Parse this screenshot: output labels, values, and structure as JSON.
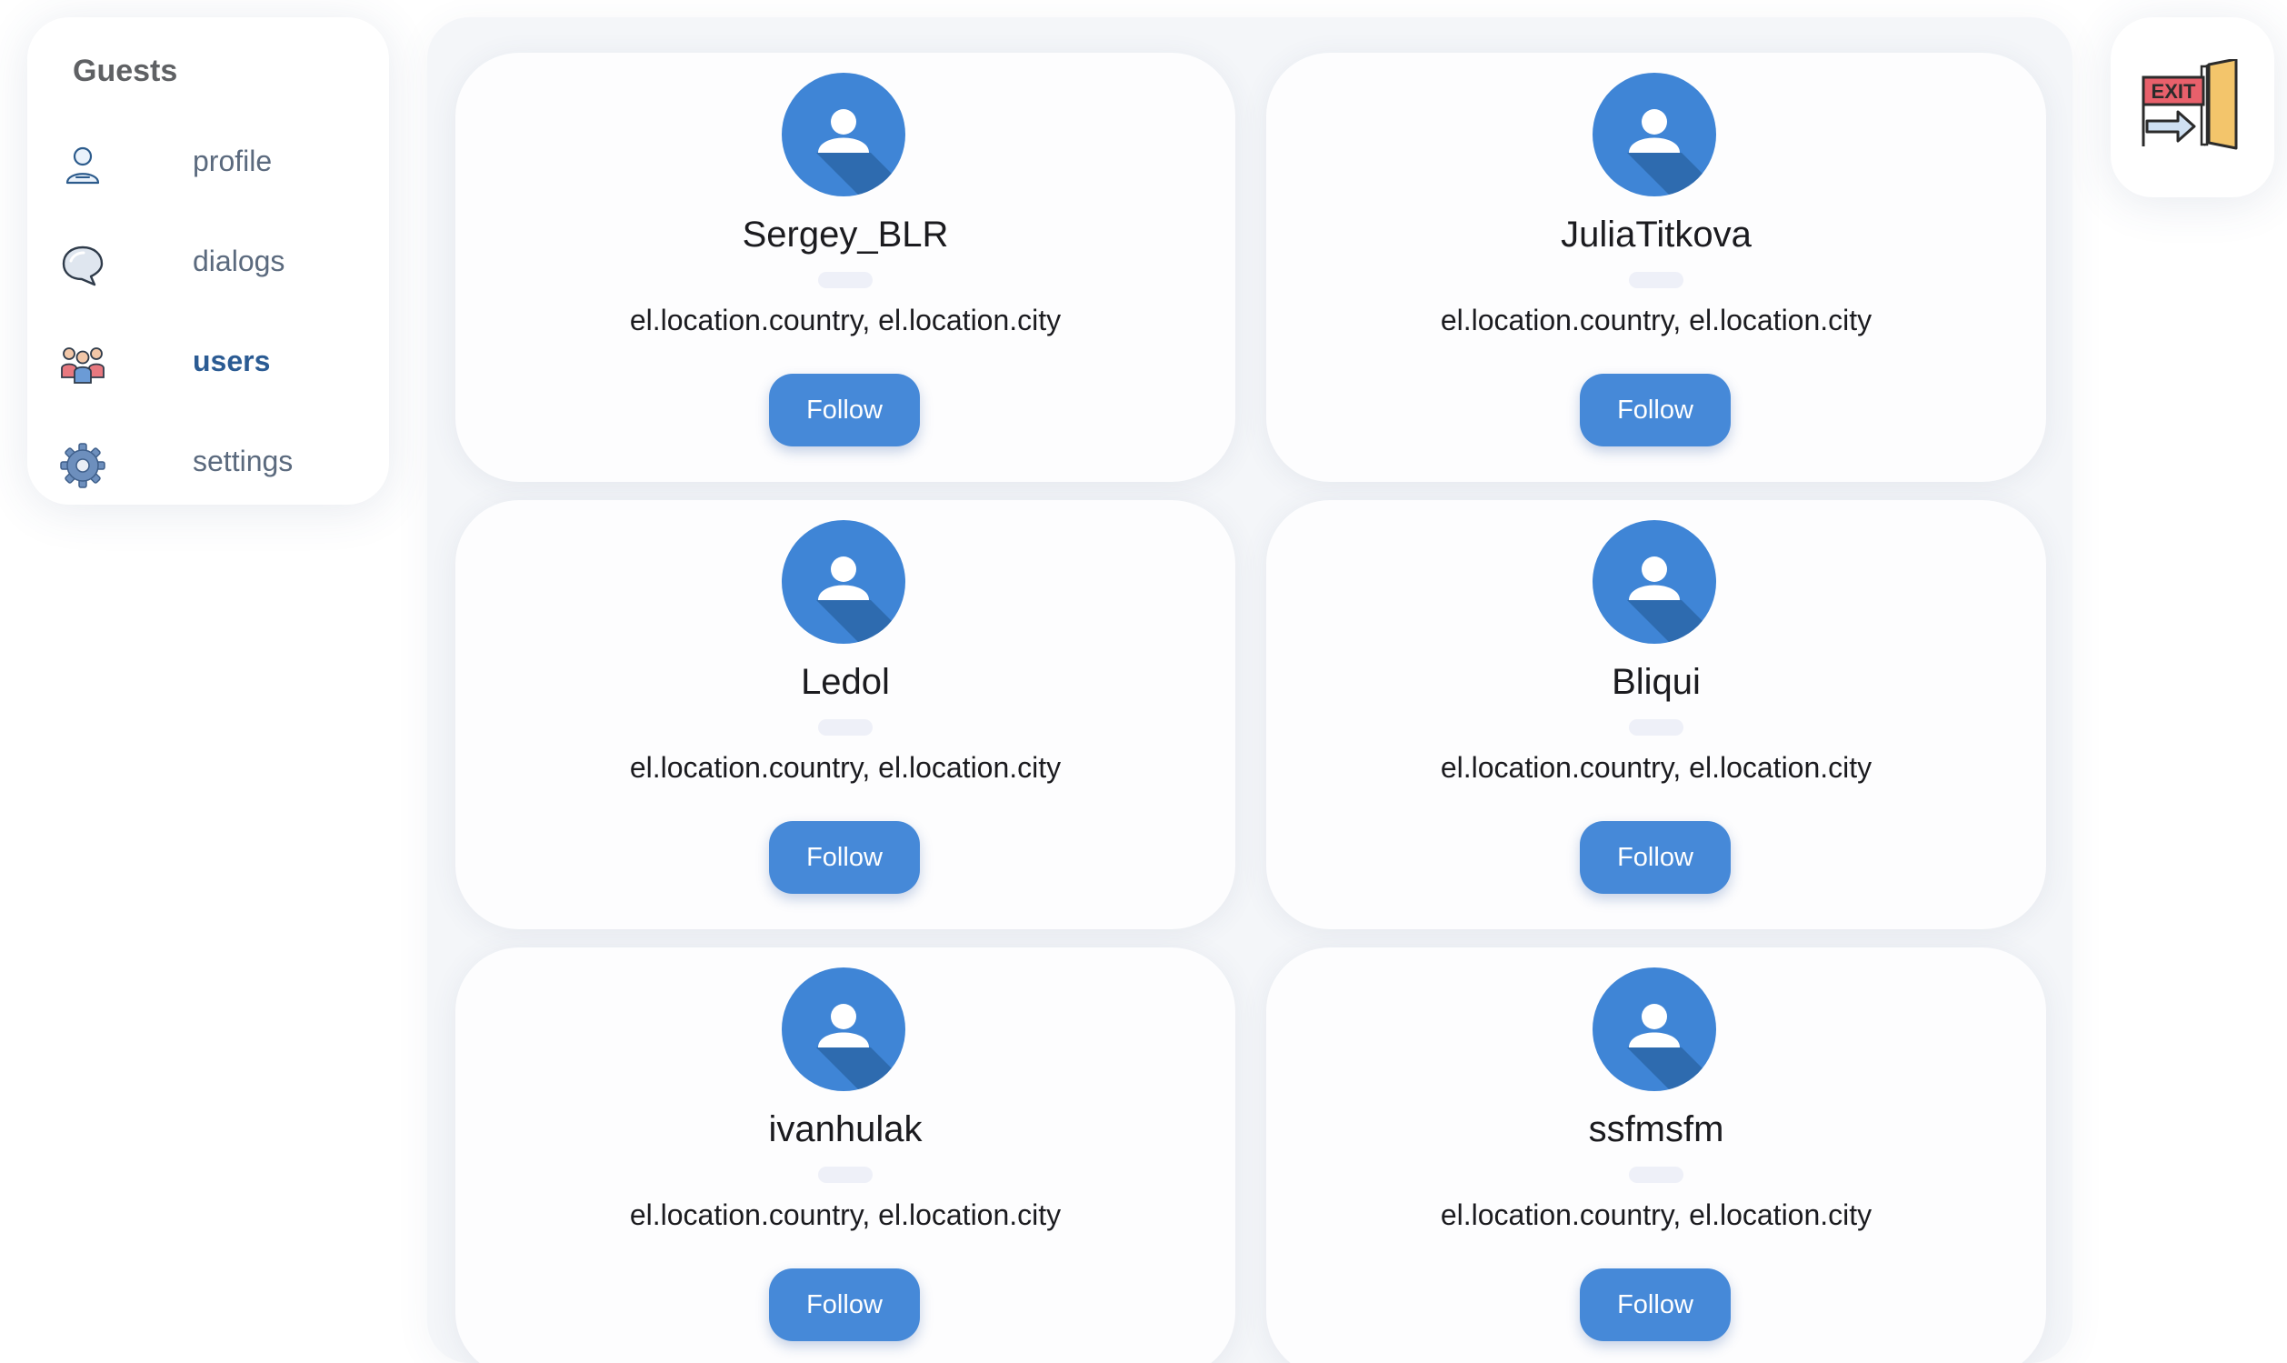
{
  "sidebar": {
    "title": "Guests",
    "items": [
      {
        "label": "profile",
        "icon": "user-icon",
        "active": false
      },
      {
        "label": "dialogs",
        "icon": "chat-bubble-icon",
        "active": false
      },
      {
        "label": "users",
        "icon": "users-group-icon",
        "active": true
      },
      {
        "label": "settings",
        "icon": "gear-icon",
        "active": false
      }
    ]
  },
  "users": [
    {
      "name": "Sergey_BLR",
      "location": "el.location.country, el.location.city",
      "button": "Follow"
    },
    {
      "name": "JuliaTitkova",
      "location": "el.location.country, el.location.city",
      "button": "Follow"
    },
    {
      "name": "Ledol",
      "location": "el.location.country, el.location.city",
      "button": "Follow"
    },
    {
      "name": "Bliqui",
      "location": "el.location.country, el.location.city",
      "button": "Follow"
    },
    {
      "name": "ivanhulak",
      "location": "el.location.country, el.location.city",
      "button": "Follow"
    },
    {
      "name": "ssfmsfm",
      "location": "el.location.country, el.location.city",
      "button": "Follow"
    }
  ],
  "exit": {
    "icon": "exit-door-icon",
    "sign_text": "EXIT"
  },
  "colors": {
    "accent": "#4689d8",
    "avatar": "#3f85d6",
    "active_nav": "#2b5b93",
    "nav_text": "#5b6a7e"
  }
}
